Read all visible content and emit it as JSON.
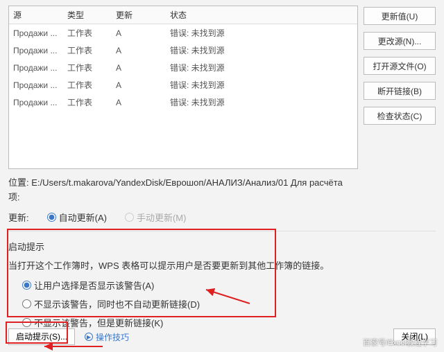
{
  "table": {
    "headers": {
      "source": "源",
      "type": "类型",
      "update": "更新",
      "status": "状态"
    },
    "rows": [
      {
        "source": "Продажи ...",
        "type": "工作表",
        "update": "A",
        "status": "错误: 未找到源"
      },
      {
        "source": "Продажи ...",
        "type": "工作表",
        "update": "A",
        "status": "错误: 未找到源"
      },
      {
        "source": "Продажи ...",
        "type": "工作表",
        "update": "A",
        "status": "错误: 未找到源"
      },
      {
        "source": "Продажи ...",
        "type": "工作表",
        "update": "A",
        "status": "错误: 未找到源"
      },
      {
        "source": "Продажи ...",
        "type": "工作表",
        "update": "A",
        "status": "错误: 未找到源"
      }
    ]
  },
  "side": {
    "update_value": "更新值(U)",
    "change_source": "更改源(N)...",
    "open_source": "打开源文件(O)",
    "break_link": "断开链接(B)",
    "check_status": "检查状态(C)"
  },
  "location": {
    "label": "位置:",
    "path": "E:/Users/t.makarova/YandexDisk/Еврошоп/АНАЛИЗ/Анализ/01 Для расчёта",
    "item": "项:"
  },
  "update_mode": {
    "label": "更新:",
    "auto": "自动更新(A)",
    "manual": "手动更新(M)"
  },
  "startup": {
    "title": "启动提示",
    "desc": "当打开这个工作簿时，WPS 表格可以提示用户是否要更新到其他工作簿的链接。",
    "opt_ask": "让用户选择是否显示该警告(A)",
    "opt_no_update": "不显示该警告，同时也不自动更新链接(D)",
    "opt_update": "不显示该警告，但是更新链接(K)"
  },
  "bottom": {
    "startup_button": "启动提示(S)...",
    "tips": "操作技巧",
    "close": "关闭(L)"
  },
  "watermark": "百家号/Excel教程学习"
}
